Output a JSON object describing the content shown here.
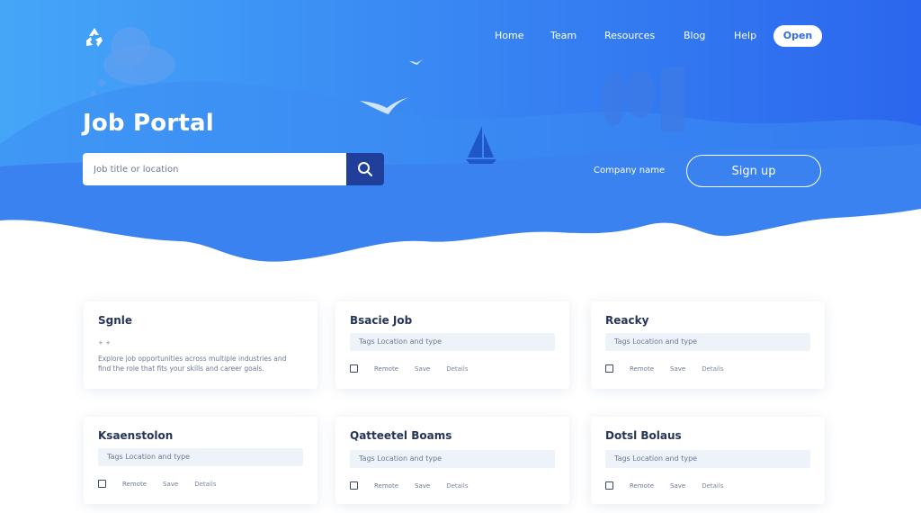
{
  "nav": {
    "items": [
      "Home",
      "Team",
      "Resources",
      "Blog",
      "Help"
    ],
    "cta": "Open"
  },
  "hero": {
    "title": "Job Portal",
    "search_placeholder": "Job title or location",
    "hint": "Company name",
    "signup_label": "Sign up"
  },
  "cards": [
    {
      "title": "Sgnle",
      "row": "+ +",
      "desc": "Explore job opportunities across multiple industries and find the role that fits your skills and career goals.",
      "meta": [
        "",
        "",
        ""
      ]
    },
    {
      "title": "Bsacie Job",
      "row": "Tags   Location and type",
      "meta": [
        "Remote",
        "Save",
        "Details"
      ]
    },
    {
      "title": "Reacky",
      "row": "Tags   Location and type",
      "meta": [
        "Remote",
        "Save",
        "Details"
      ]
    },
    {
      "title": "Ksaenstolon",
      "row": "Tags   Location and type",
      "meta": [
        "Remote",
        "Save",
        "Details"
      ]
    },
    {
      "title": "Qatteetel Boams",
      "row": "Tags   Location and type",
      "meta": [
        "Remote",
        "Save",
        "Details"
      ]
    },
    {
      "title": "Dotsl Bolaus",
      "row": "Tags   Location and type",
      "meta": [
        "Remote",
        "Save",
        "Details"
      ]
    }
  ],
  "colors": {
    "hero_top": "#4aa8f7",
    "hero_bottom": "#2a6cf0",
    "search_button": "#1f3f9a",
    "card_title": "#26345a"
  }
}
